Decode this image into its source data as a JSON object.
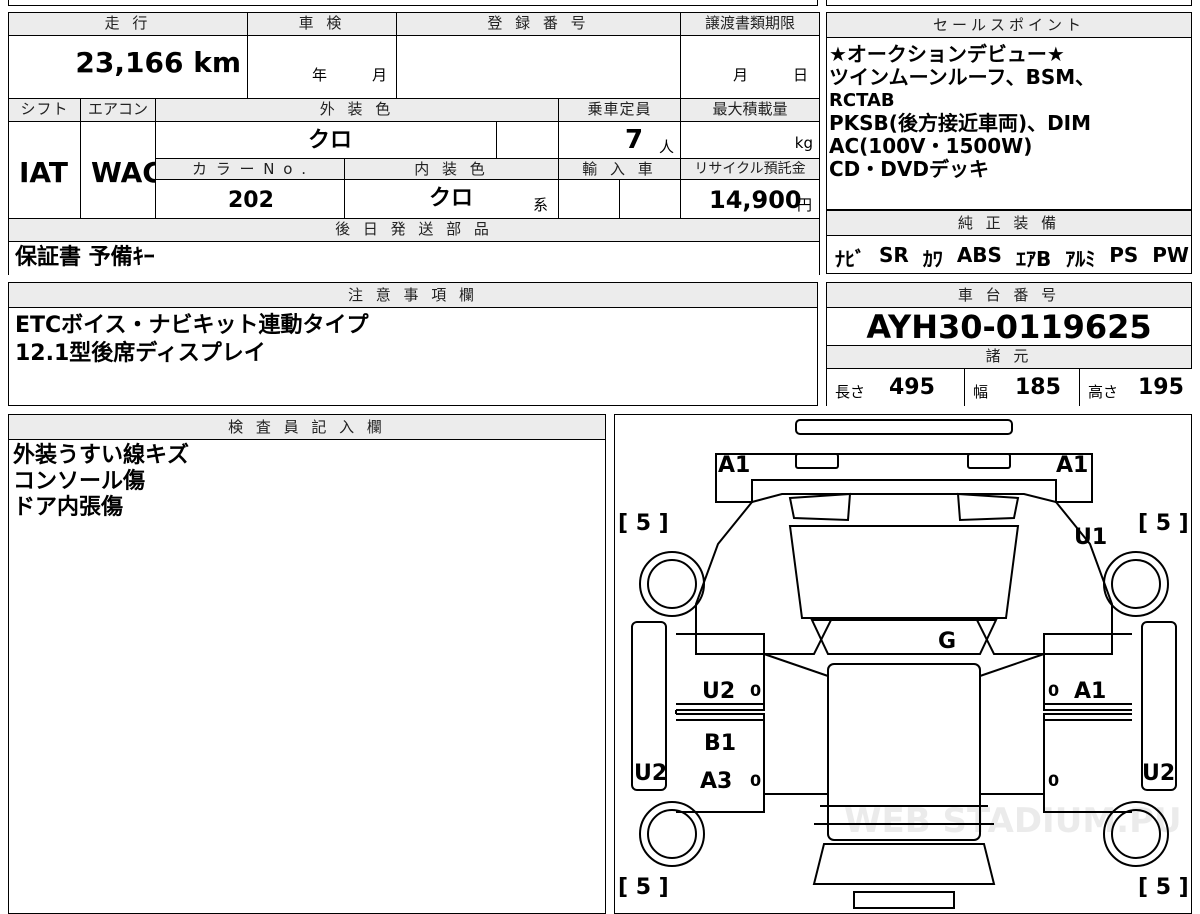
{
  "top_sheet": {
    "hdr_mileage": "走 行",
    "mileage": "23,166 km",
    "hdr_inspection": "車 検",
    "inspection_year_unit": "年",
    "inspection_month_unit": "月",
    "hdr_registration": "登 録 番 号",
    "hdr_transfer_deadline": "譲渡書類期限",
    "deadline_month_unit": "月",
    "deadline_day_unit": "日",
    "hdr_shift": "シフト",
    "shift": "IAT",
    "hdr_ac": "エアコン",
    "ac": "WAC",
    "hdr_exterior_color": "外 装 色",
    "exterior_color": "クロ",
    "hdr_capacity": "乗車定員",
    "capacity": "7",
    "capacity_unit": "人",
    "hdr_max_load": "最大積載量",
    "max_load_unit": "kg",
    "hdr_color_no": "カ ラ ー N o .",
    "color_no": "202",
    "hdr_interior_color": "内 装 色",
    "interior_color": "クロ",
    "interior_suffix": "系",
    "hdr_import": "輸 入 車",
    "hdr_recycle_fee": "リサイクル預託金",
    "recycle_fee": "14,900",
    "recycle_unit": "円",
    "hdr_later_parts": "後 日 発 送 部 品",
    "later_parts": "保証書 予備ｷｰ"
  },
  "sales_points": {
    "header": "セールスポイント",
    "lines": [
      "★オークションデビュー★",
      "ツインムーンルーフ、BSM、",
      "RCTAB",
      "PKSB(後方接近車両)、DIM",
      "AC(100V・1500W)",
      "CD・DVDデッキ"
    ]
  },
  "genuine_equipment": {
    "header": "純 正 装 備",
    "items": [
      "ﾅﾋﾞ",
      "SR",
      "ｶﾜ",
      "ABS",
      "ｴｱB",
      "ｱﾙﾐ",
      "PS",
      "PW"
    ]
  },
  "notes": {
    "header": "注 意 事 項 欄",
    "lines": [
      "ETCボイス・ナビキット連動タイプ",
      "12.1型後席ディスプレイ"
    ]
  },
  "chassis": {
    "header": "車 台 番 号",
    "number": "AYH30-0119625",
    "specs_header": "諸 元",
    "length_label": "長さ",
    "length": "495",
    "width_label": "幅",
    "width": "185",
    "height_label": "高さ",
    "height": "195"
  },
  "inspector": {
    "header": "検 査 員 記 入 欄",
    "lines": [
      "外装うすい線キズ",
      "コンソール傷",
      "ドア内張傷"
    ]
  },
  "diagram": {
    "marks": [
      "A1",
      "A1",
      "U1",
      "G",
      "U2",
      "A1",
      "B1",
      "A3",
      "U2",
      "U2"
    ],
    "tire_values": [
      "[ 5 ]",
      "[ 5 ]",
      "[ 5 ]",
      "[ 5 ]"
    ],
    "door_values": [
      "0",
      "0",
      "0",
      "0"
    ],
    "watermark": "WEB STADIUM.PU"
  }
}
